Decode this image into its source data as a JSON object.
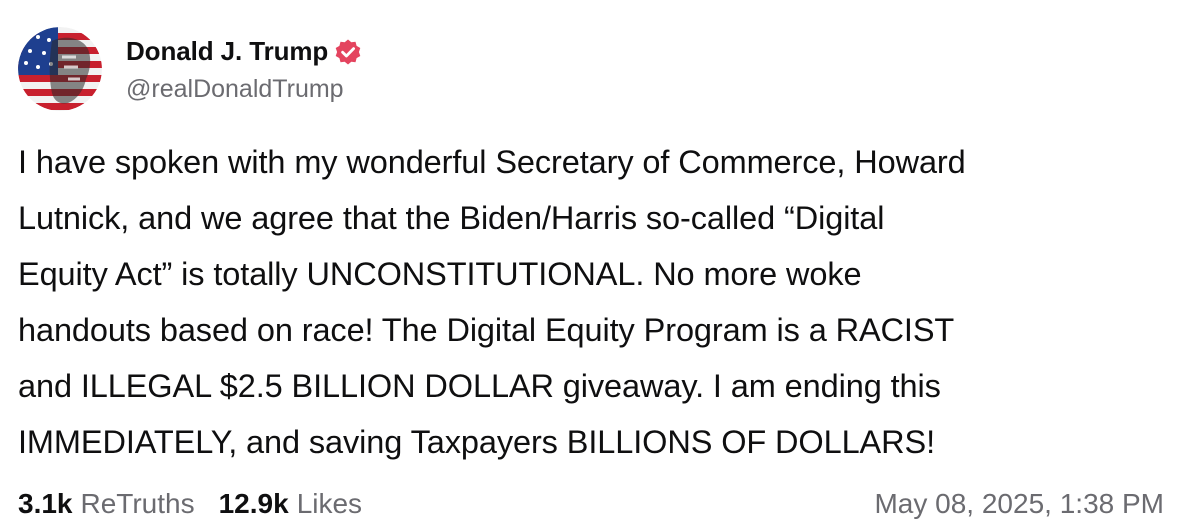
{
  "author": {
    "display_name": "Donald J. Trump",
    "handle": "@realDonaldTrump",
    "avatar_icon": "avatar-flag-portrait",
    "verified_icon": "verified-badge-icon",
    "verified_color": "#e4445f"
  },
  "post": {
    "text": "I have spoken with my wonderful Secretary of Commerce, Howard\nLutnick, and we agree that the Biden/Harris so-called “Digital\nEquity Act” is totally UNCONSTITUTIONAL. No more woke\nhandouts based on race! The Digital Equity Program is a RACIST\nand ILLEGAL $2.5 BILLION DOLLAR giveaway. I am ending this\nIMMEDIATELY, and saving Taxpayers BILLIONS OF DOLLARS!"
  },
  "stats": {
    "retruths_count": "3.1k",
    "retruths_label": "ReTruths",
    "likes_count": "12.9k",
    "likes_label": "Likes"
  },
  "timestamp": "May 08, 2025, 1:38 PM",
  "colors": {
    "text_primary": "#0f0f10",
    "text_secondary": "#6b6b70",
    "background": "#ffffff"
  }
}
